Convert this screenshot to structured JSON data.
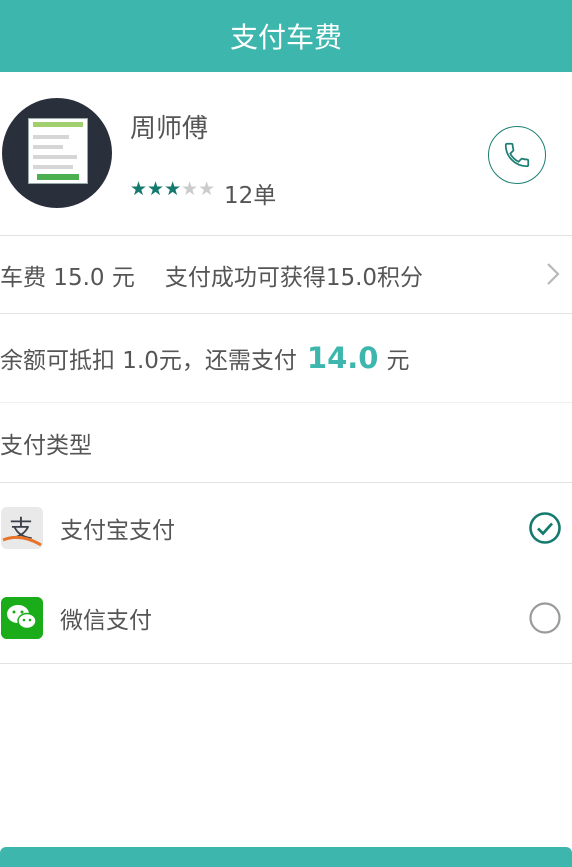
{
  "header": {
    "title": "支付车费"
  },
  "driver": {
    "name": "周师傅",
    "rating": 3,
    "rating_max": 5,
    "orders": "12单",
    "star_filled": "★★★",
    "star_empty": "★★",
    "phone_icon": "phone-icon"
  },
  "fare": {
    "fare_text": "车费 15.0 元",
    "bonus_text": "支付成功可获得15.0积分"
  },
  "balance": {
    "prefix": "余额可抵扣 1.0元，还需支付",
    "amount": "14.0",
    "suffix": "元"
  },
  "pay_type": {
    "title": "支付类型",
    "options": [
      {
        "label": "支付宝支付",
        "selected": true,
        "icon": "alipay-icon"
      },
      {
        "label": "微信支付",
        "selected": false,
        "icon": "wechat-icon"
      }
    ]
  },
  "colors": {
    "accent": "#3db6ad",
    "dark_accent": "#157a6e"
  }
}
